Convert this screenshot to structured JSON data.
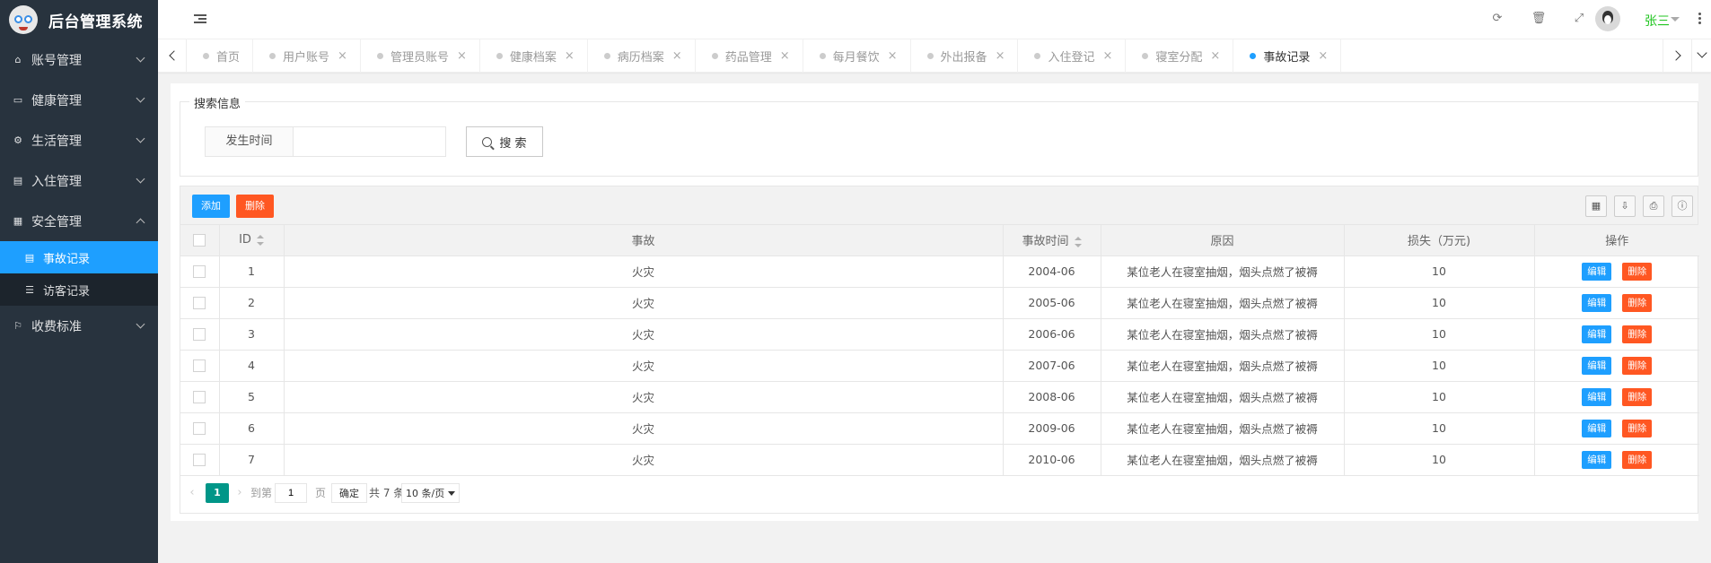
{
  "app": {
    "title": "后台管理系统"
  },
  "sidebar": {
    "items": [
      {
        "label": "账号管理",
        "icon": "home-icon"
      },
      {
        "label": "健康管理",
        "icon": "card-icon"
      },
      {
        "label": "生活管理",
        "icon": "gears-icon"
      },
      {
        "label": "入住管理",
        "icon": "file-icon"
      },
      {
        "label": "安全管理",
        "icon": "calendar-icon"
      }
    ],
    "sub_items": [
      {
        "label": "事故记录",
        "icon": "table-icon",
        "active": true
      },
      {
        "label": "访客记录",
        "icon": "list-icon",
        "active": false
      }
    ],
    "last_item": {
      "label": "收费标准",
      "icon": "flag-icon"
    }
  },
  "header": {
    "user_name": "张三",
    "icons": [
      "refresh-icon",
      "trash-icon",
      "fullscreen-icon"
    ]
  },
  "tabs": [
    {
      "label": "首页",
      "active": false
    },
    {
      "label": "用户账号",
      "active": false
    },
    {
      "label": "管理员账号",
      "active": false
    },
    {
      "label": "健康档案",
      "active": false
    },
    {
      "label": "病历档案",
      "active": false
    },
    {
      "label": "药品管理",
      "active": false
    },
    {
      "label": "每月餐饮",
      "active": false
    },
    {
      "label": "外出报备",
      "active": false
    },
    {
      "label": "入住登记",
      "active": false
    },
    {
      "label": "寝室分配",
      "active": false
    },
    {
      "label": "事故记录",
      "active": true
    }
  ],
  "search": {
    "legend": "搜索信息",
    "field_label": "发生时间",
    "field_value": "",
    "button_label": "搜 索"
  },
  "toolbar": {
    "add_label": "添加",
    "delete_label": "删除"
  },
  "table": {
    "headers": {
      "id": "ID",
      "event": "事故",
      "time": "事故时间",
      "reason": "原因",
      "loss": "损失（万元)",
      "ops": "操作"
    },
    "rows": [
      {
        "id": "1",
        "event": "火灾",
        "time": "2004-06",
        "reason": "某位老人在寝室抽烟，烟头点燃了被褥",
        "loss": "10"
      },
      {
        "id": "2",
        "event": "火灾",
        "time": "2005-06",
        "reason": "某位老人在寝室抽烟，烟头点燃了被褥",
        "loss": "10"
      },
      {
        "id": "3",
        "event": "火灾",
        "time": "2006-06",
        "reason": "某位老人在寝室抽烟，烟头点燃了被褥",
        "loss": "10"
      },
      {
        "id": "4",
        "event": "火灾",
        "time": "2007-06",
        "reason": "某位老人在寝室抽烟，烟头点燃了被褥",
        "loss": "10"
      },
      {
        "id": "5",
        "event": "火灾",
        "time": "2008-06",
        "reason": "某位老人在寝室抽烟，烟头点燃了被褥",
        "loss": "10"
      },
      {
        "id": "6",
        "event": "火灾",
        "time": "2009-06",
        "reason": "某位老人在寝室抽烟，烟头点燃了被褥",
        "loss": "10"
      },
      {
        "id": "7",
        "event": "火灾",
        "time": "2010-06",
        "reason": "某位老人在寝室抽烟，烟头点燃了被褥",
        "loss": "10"
      }
    ],
    "edit_label": "编辑",
    "delete_label": "删除"
  },
  "pager": {
    "current": "1",
    "goto_label": "到第",
    "goto_value": "1",
    "page_unit": "页",
    "ok_label": "确定",
    "total_label": "共 7 条",
    "page_size": "10 条/页"
  },
  "colors": {
    "sidebar_bg": "#28333e",
    "accent_blue": "#1e9fff",
    "danger_orange": "#ff5722",
    "pager_green": "#009688",
    "user_green": "#20c520"
  }
}
